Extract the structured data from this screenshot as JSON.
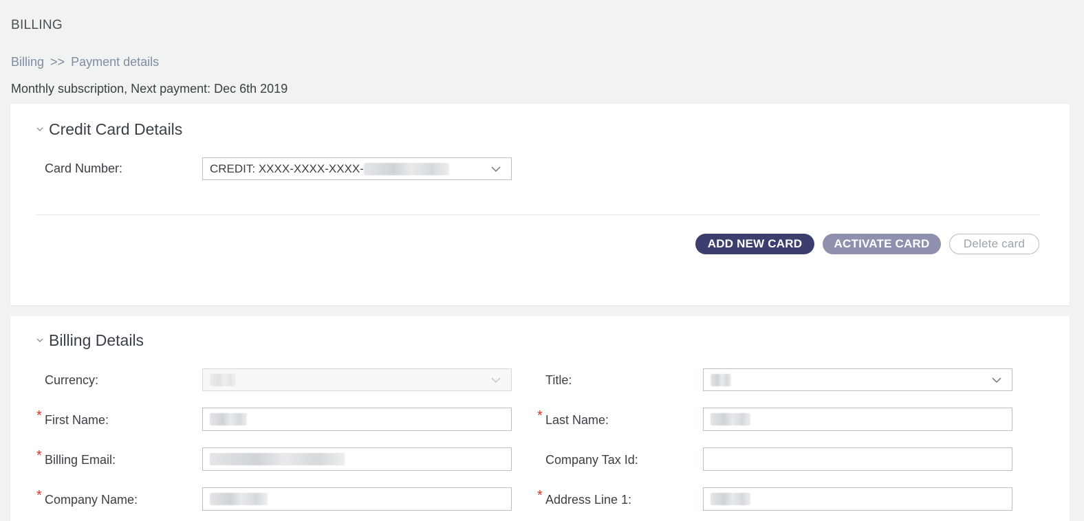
{
  "page": {
    "title": "BILLING",
    "breadcrumb": {
      "root": "Billing",
      "separator": ">>",
      "current": "Payment details"
    },
    "subscription_text": "Monthly subscription, Next payment: Dec 6th 2019"
  },
  "credit_card_section": {
    "title": "Credit Card Details",
    "card_number_label": "Card Number:",
    "card_number_value": "CREDIT: XXXX-XXXX-XXXX-",
    "buttons": {
      "add_new_card": "ADD NEW CARD",
      "activate_card": "ACTIVATE CARD",
      "delete_card": "Delete card"
    }
  },
  "billing_section": {
    "title": "Billing Details",
    "fields": {
      "currency": {
        "label": "Currency:"
      },
      "title": {
        "label": "Title:"
      },
      "first_name": {
        "label": "First Name:",
        "required": true
      },
      "last_name": {
        "label": "Last Name:",
        "required": true
      },
      "billing_email": {
        "label": "Billing Email:",
        "required": true
      },
      "company_tax_id": {
        "label": "Company Tax Id:"
      },
      "company_name": {
        "label": "Company Name:",
        "required": true
      },
      "address_line_1": {
        "label": "Address Line 1:",
        "required": true
      }
    },
    "required_marker": "*"
  },
  "colors": {
    "primary_button": "#3c3f6e",
    "secondary_button": "#8e90ae",
    "required": "#d9352b",
    "breadcrumb": "#7d8ea0"
  }
}
